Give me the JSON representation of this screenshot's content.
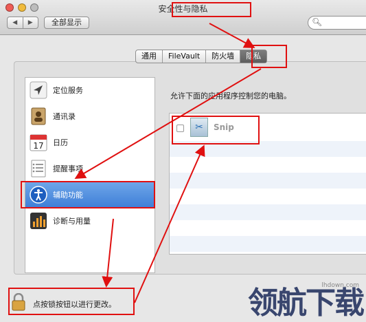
{
  "window": {
    "title": "安全性与隐私",
    "nav_back": "◀",
    "nav_forward": "▶",
    "show_all_label": "全部显示",
    "search_placeholder": ""
  },
  "tabs": [
    {
      "label": "通用",
      "selected": false
    },
    {
      "label": "FileVault",
      "selected": false
    },
    {
      "label": "防火墙",
      "selected": false
    },
    {
      "label": "隐私",
      "selected": true
    }
  ],
  "sidebar": {
    "items": [
      {
        "label": "定位服务",
        "icon": "location-icon",
        "selected": false
      },
      {
        "label": "通讯录",
        "icon": "contacts-icon",
        "selected": false
      },
      {
        "label": "日历",
        "icon": "calendar-icon",
        "calendar_day": "17",
        "selected": false
      },
      {
        "label": "提醒事项",
        "icon": "reminders-icon",
        "selected": false
      },
      {
        "label": "辅助功能",
        "icon": "accessibility-icon",
        "selected": true
      },
      {
        "label": "诊断与用量",
        "icon": "diagnostics-icon",
        "selected": false
      }
    ]
  },
  "main": {
    "description": "允许下面的应用程序控制您的电脑。",
    "apps": [
      {
        "name": "Snip",
        "checked": false,
        "icon": "snip-icon"
      }
    ]
  },
  "footer": {
    "lock_text": "点按锁按钮以进行更改。"
  },
  "watermark": {
    "text": "领航下载",
    "url": "lhdown.com"
  },
  "annotation_color": "#e01010"
}
